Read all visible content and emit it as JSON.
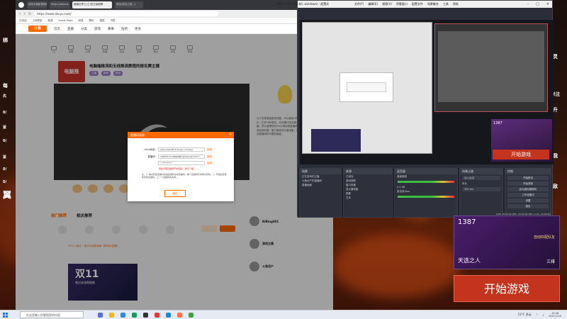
{
  "browser": {
    "tabs": [
      "成功长城影视网络",
      "https://www.d...",
      "魔兽世界之(之)的正版图腾",
      "成功(成功之成...)"
    ],
    "address": "https://www.douyu.com/",
    "bookmarks": [
      "已添加",
      "上网导航",
      "新浪",
      "Inside Page",
      "网易",
      "腾讯",
      "搜狐",
      "书签"
    ],
    "site_logo": "斗鱼",
    "nav": [
      "首页",
      "直播",
      "分类",
      "游戏",
      "赛事",
      "鱼吧",
      "更多"
    ],
    "tools": [
      "12",
      "设置",
      "分享",
      "收藏",
      "投诉",
      "录像",
      "鱼丸",
      "消息",
      "帮助"
    ],
    "room_title": "电脑端推流和无线推流教程的报名赛主播",
    "room_thumb": "电脑推",
    "tags": [
      "主播",
      "推荐",
      "推流"
    ],
    "side_text": "为了实现电脑推流流程，可以使用OBS第三方推流软件：第一步，打开OBS软件，在设置中找到推流选项，选择自定义服务器，把斗鱼提供的rtmp地址和直播码复制到对应位置；第二步，添加游戏源、窗口源或显示器采集；第三步，点击开始推流，回到直播间即可看到画面。",
    "bottom_tabs": [
      "热门推荐",
      "相关推荐"
    ],
    "rec_text": "2021斗鱼十一笔记本选购指南【新笔补贴篇】",
    "promo_title": "双11",
    "promo_sub": "笔记本选购指南",
    "user_names": [
      "NiBing001",
      "游戏主播",
      "斗鱼用户"
    ]
  },
  "dialog": {
    "title": "直播码获取",
    "close": "×",
    "rows": [
      {
        "label": "rtmp地址:",
        "value": "rtmp://sendfc3.douyu.com/live",
        "copy": "复制"
      },
      {
        "label": "直播码:",
        "value": "10912471caf9fa08d?wsSecret=a****",
        "copy": "复制"
      },
      {
        "label": "",
        "value": "* *********",
        "copy": "复制"
      }
    ],
    "warning": "特别声明直播码严禁泄露！ 我已了解",
    "notes": "注：1. 每次开始直播时系统会重新生成直播码，每个直播码仅本场次有效。 2. 开播后若重新获取直播码，上一个直播码将失效。",
    "ok": "确定"
  },
  "obs": {
    "title": "OBS 27.0.1 (64-bit, windows) - 配置文件: 未命名 - 场景: 未命名",
    "menu": [
      "文件(F)",
      "编辑(E)",
      "视图(V)",
      "停靠窗口",
      "配置文件",
      "场景集合",
      "工具",
      "帮助"
    ],
    "game_count": "1387",
    "game_button": "开始游戏",
    "docks": {
      "scenes": {
        "title": "场景",
        "items": [
          "正在游戏的主播",
          "斗鱼出产的直播间",
          "直播画面"
        ]
      },
      "sources": {
        "title": "来源",
        "items": [
          "已添加",
          "游戏捕获",
          "窗口采集",
          "显示器采集",
          "图像",
          "文本"
        ]
      },
      "audio": {
        "title": "混音器",
        "channels": [
          "桌面音频",
          "麦克风/Aux"
        ],
        "db": "0.0 dB"
      },
      "transitions": {
        "title": "场景过渡",
        "fade": "淡入淡出",
        "duration_label": "时长",
        "duration": "300 ms"
      },
      "controls": {
        "title": "控制",
        "buttons": [
          "开始推流",
          "开始录制",
          "启动虚拟摄像机",
          "工作室模式",
          "设置",
          "退出"
        ]
      }
    },
    "status": "LIVE: 00:00:00  REC: 00:00:00  CPU: 2.1%, 30.00 fps"
  },
  "overlay": {
    "left_labels": [
      "绑",
      "每",
      "先",
      "0/",
      "紧",
      "0/",
      "紧",
      "0/",
      "0/",
      "翼"
    ],
    "right_labels": [
      "灵",
      "关注",
      "升",
      "我",
      "敌"
    ],
    "count": "1387",
    "hero": "天选之人",
    "mode": "三排",
    "notice": "自动匹配队友",
    "start": "开始游戏"
  },
  "taskbar": {
    "search": "在这里输入你要搜索的内容",
    "weather": "13°C 多云",
    "time": "10:48",
    "date": "2021/11/4"
  },
  "colors": {
    "douyu_orange": "#ff6a00",
    "obs_dark": "#2b2e38",
    "game_red": "#c4331e"
  }
}
